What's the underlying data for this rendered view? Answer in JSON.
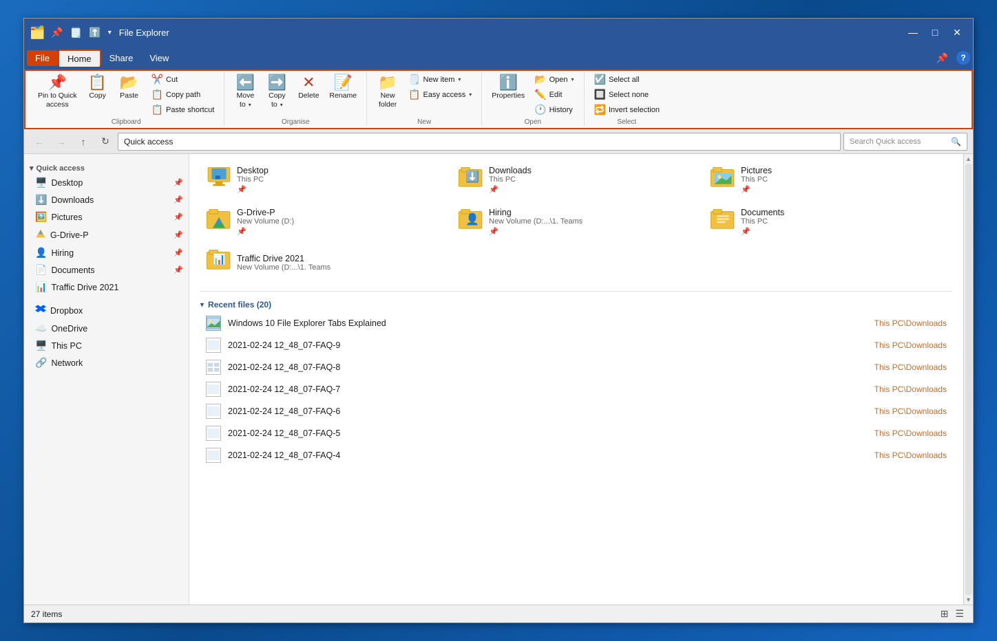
{
  "window": {
    "title": "File Explorer",
    "icon": "🗂️"
  },
  "titlebar": {
    "qat_buttons": [
      "📌",
      "🗒️",
      "⬆️"
    ],
    "dropdown": "▾",
    "minimize": "—",
    "maximize": "□",
    "close": "✕"
  },
  "menubar": {
    "items": [
      "File",
      "Home",
      "Share",
      "View"
    ],
    "active": "Home",
    "file_active": true
  },
  "ribbon": {
    "clipboard": {
      "label": "Clipboard",
      "pin_to_quick_access": "Pin to Quick\naccess",
      "copy": "Copy",
      "paste": "Paste",
      "cut": "Cut",
      "copy_path": "Copy path",
      "paste_shortcut": "Paste shortcut"
    },
    "organise": {
      "label": "Organise",
      "move_to": "Move\nto",
      "copy_to": "Copy\nto",
      "delete": "Delete",
      "rename": "Rename"
    },
    "new": {
      "label": "New",
      "new_folder": "New\nfolder",
      "new_item": "New item",
      "easy_access": "Easy access"
    },
    "open": {
      "label": "Open",
      "open": "Open",
      "edit": "Edit",
      "history": "History",
      "properties": "Properties"
    },
    "select": {
      "label": "Select",
      "select_all": "Select all",
      "select_none": "Select none",
      "invert_selection": "Invert selection"
    }
  },
  "navbar": {
    "address": "Quick access",
    "search_placeholder": "Search Quick access"
  },
  "sidebar": {
    "quick_access": {
      "label": "Quick access",
      "items": [
        {
          "name": "Desktop",
          "icon": "🖥️",
          "pinned": true
        },
        {
          "name": "Downloads",
          "icon": "⬇️",
          "pinned": true
        },
        {
          "name": "Pictures",
          "icon": "🖼️",
          "pinned": true
        },
        {
          "name": "G-Drive-P",
          "icon": "📁",
          "pinned": true
        },
        {
          "name": "Hiring",
          "icon": "👤",
          "pinned": true
        },
        {
          "name": "Documents",
          "icon": "📄",
          "pinned": true
        },
        {
          "name": "Traffic Drive 2021",
          "icon": "📊",
          "pinned": false
        }
      ]
    },
    "cloud": {
      "items": [
        {
          "name": "Dropbox",
          "icon": "💠"
        },
        {
          "name": "OneDrive",
          "icon": "☁️"
        }
      ]
    },
    "system": {
      "items": [
        {
          "name": "This PC",
          "icon": "🖥️"
        },
        {
          "name": "Network",
          "icon": "🔗"
        }
      ]
    }
  },
  "content": {
    "pinned_items": [
      {
        "name": "Desktop",
        "path": "This PC",
        "icon": "desktop",
        "has_overlay": false
      },
      {
        "name": "Downloads",
        "path": "This PC",
        "icon": "downloads",
        "has_overlay": true
      },
      {
        "name": "Pictures",
        "path": "This PC",
        "icon": "pictures",
        "has_overlay": false
      },
      {
        "name": "G-Drive-P",
        "path": "New Volume (D:)",
        "icon": "gdrive",
        "has_overlay": true
      },
      {
        "name": "Hiring",
        "path": "New Volume (D:...\\1. Teams",
        "icon": "hiring",
        "has_overlay": true
      },
      {
        "name": "Documents",
        "path": "This PC",
        "icon": "documents",
        "has_overlay": false
      },
      {
        "name": "Traffic Drive 2021",
        "path": "New Volume (D:...\\1. Teams",
        "icon": "traffic",
        "has_overlay": false
      }
    ],
    "recent_section": {
      "label": "Recent files (20)",
      "items": [
        {
          "name": "Windows 10 File Explorer Tabs Explained",
          "path": "This PC\\Downloads",
          "type": "image"
        },
        {
          "name": "2021-02-24 12_48_07-FAQ-9",
          "path": "This PC\\Downloads",
          "type": "doc"
        },
        {
          "name": "2021-02-24 12_48_07-FAQ-8",
          "path": "This PC\\Downloads",
          "type": "grid"
        },
        {
          "name": "2021-02-24 12_48_07-FAQ-7",
          "path": "This PC\\Downloads",
          "type": "doc"
        },
        {
          "name": "2021-02-24 12_48_07-FAQ-6",
          "path": "This PC\\Downloads",
          "type": "doc"
        },
        {
          "name": "2021-02-24 12_48_07-FAQ-5",
          "path": "This PC\\Downloads",
          "type": "doc"
        },
        {
          "name": "2021-02-24 12_48_07-FAQ-4",
          "path": "This PC\\Downloads",
          "type": "doc"
        }
      ]
    }
  },
  "statusbar": {
    "count": "27 items"
  }
}
